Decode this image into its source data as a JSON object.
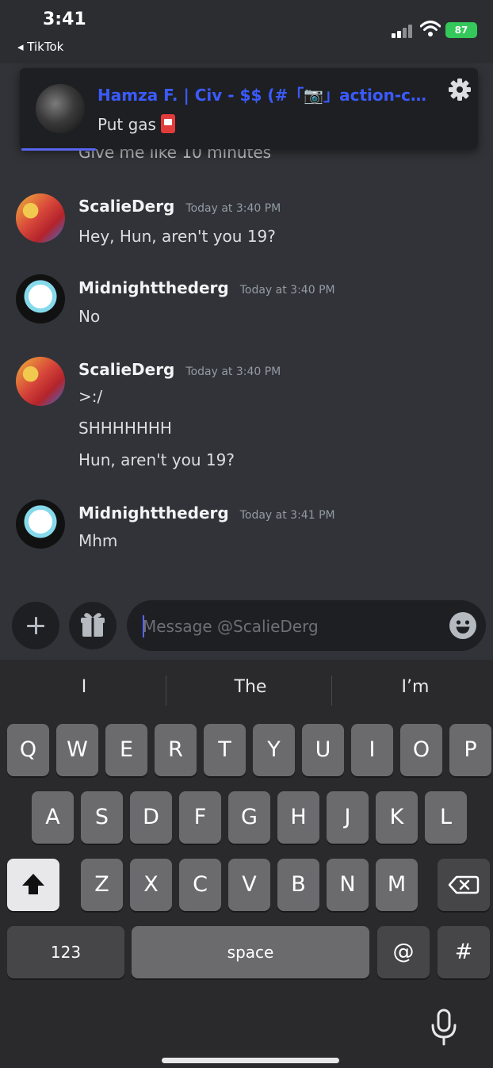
{
  "status": {
    "time": "3:41",
    "back_app": "◂ TikTok",
    "battery": "87"
  },
  "notification": {
    "title": "Hamza F. | Civ - $$ (#「📷」action-ch...",
    "body": "Put gas"
  },
  "chat": {
    "cut_message": "Give me like 10 minutes",
    "messages": [
      {
        "author": "ScalieDerg",
        "time": "Today at 3:40 PM",
        "lines": [
          "Hey, Hun, aren't you 19?"
        ]
      },
      {
        "author": "Midnightthederg",
        "time": "Today at 3:40 PM",
        "lines": [
          "No"
        ]
      },
      {
        "author": "ScalieDerg",
        "time": "Today at 3:40 PM",
        "lines": [
          ">:/",
          "SHHHHHHH",
          "Hun, aren't you 19?"
        ]
      },
      {
        "author": "Midnightthederg",
        "time": "Today at 3:41 PM",
        "lines": [
          "Mhm"
        ]
      }
    ]
  },
  "composer": {
    "placeholder": "Message @ScalieDerg"
  },
  "keyboard": {
    "suggestions": [
      "I",
      "The",
      "I’m"
    ],
    "row1": [
      "Q",
      "W",
      "E",
      "R",
      "T",
      "Y",
      "U",
      "I",
      "O",
      "P"
    ],
    "row2": [
      "A",
      "S",
      "D",
      "F",
      "G",
      "H",
      "J",
      "K",
      "L"
    ],
    "row3": [
      "Z",
      "X",
      "C",
      "V",
      "B",
      "N",
      "M"
    ],
    "numbers_label": "123",
    "space_label": "space",
    "at_label": "@",
    "hash_label": "#"
  },
  "icons": {
    "gear": "gear-icon",
    "plus": "plus-icon",
    "gift": "gift-icon",
    "emoji": "emoji-icon",
    "shift": "shift-icon",
    "backspace": "backspace-icon",
    "mic": "microphone-icon"
  },
  "colors": {
    "background": "#313338",
    "notification_title": "#3a5bff",
    "accent": "#5865f2",
    "battery": "#34c759"
  }
}
